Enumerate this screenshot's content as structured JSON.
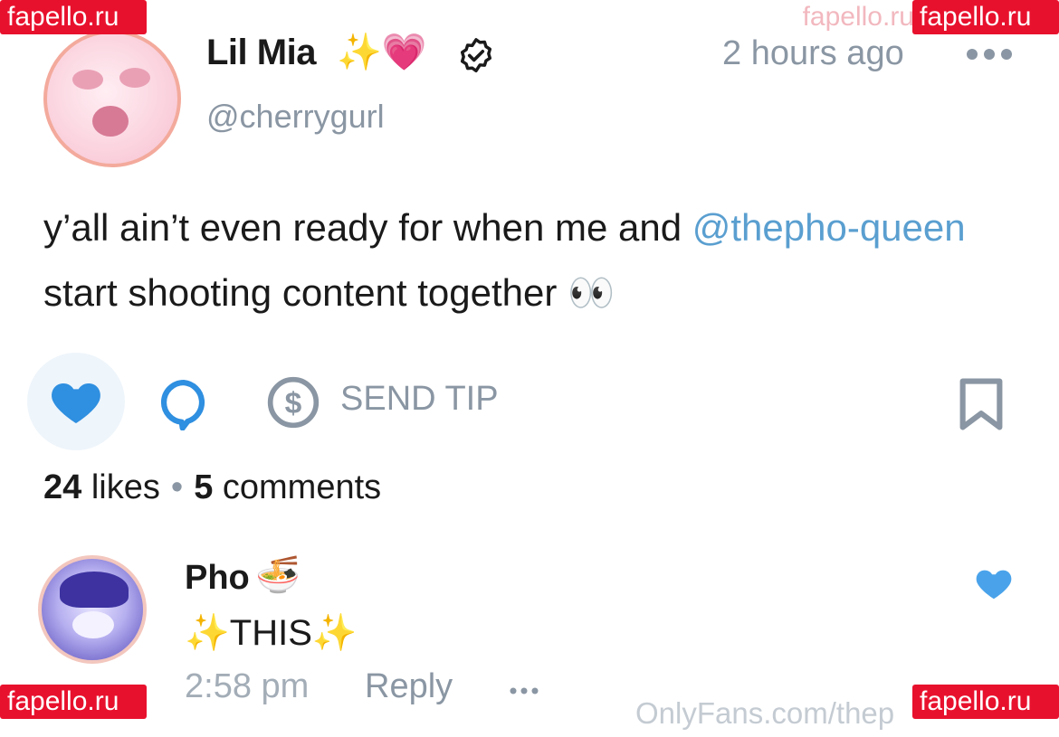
{
  "watermarks": {
    "top_left": "fapello.ru",
    "top_right": "fapello.ru",
    "bottom_left": "fapello.ru",
    "bottom_right": "fapello.ru",
    "faint": "fapello.ru"
  },
  "post": {
    "author_name": "Lil Mia",
    "author_emojis": "✨💗",
    "handle": "@cherrygurl",
    "timestamp": "2 hours ago",
    "text_part1": "y’all ain’t even ready for when me and ",
    "mention": "@thepho-queen",
    "text_part2": " start shooting content together ",
    "text_emoji": "👀"
  },
  "actions": {
    "send_tip_label": "SEND TIP"
  },
  "stats": {
    "likes_count": "24",
    "likes_label": "likes",
    "separator": "•",
    "comments_count": "5",
    "comments_label": "comments"
  },
  "comment": {
    "author_name": "Pho",
    "author_emoji": "🍜",
    "text": "✨THIS✨",
    "time": "2:58 pm",
    "reply_label": "Reply"
  },
  "footer": {
    "onlyfans_url": "OnlyFans.com/thep"
  },
  "colors": {
    "accent": "#00aff0",
    "heart": "#2f8fe0",
    "mention": "#5a9fd0",
    "muted": "#8a96a3",
    "watermark": "#e8112d"
  },
  "icons": {
    "verified": "verified-badge-icon",
    "more": "more-dots-icon",
    "like": "heart-icon",
    "comment": "comment-bubble-icon",
    "tip": "dollar-circle-icon",
    "bookmark": "bookmark-icon"
  }
}
